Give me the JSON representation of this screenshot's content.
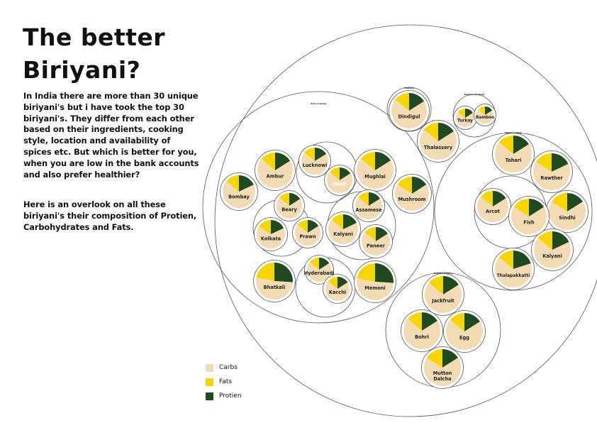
{
  "title": "The better Biriyani?",
  "paragraphs": [
    "In India there are more than 30 unique biriyani's but i have took the top 30 biriyani's. They differ from each other based on their ingredients, cooking style, location and availability of spices etc. But which is better for you, when you are low in the bank accounts and also prefer healthier?",
    "Here is an overlook on all these biriyani's their composition of Protien, Carbohydrates and Fats."
  ],
  "colors": {
    "carbs": "#f3dcb4",
    "fats": "#f6d500",
    "protein": "#1f4a1f",
    "outline": "#555555"
  },
  "legend": [
    {
      "key": "carbs",
      "label": "Carbs"
    },
    {
      "key": "fats",
      "label": "Fats"
    },
    {
      "key": "protein",
      "label": "Protien"
    }
  ],
  "chart_data": {
    "type": "pie",
    "layout": "nested-circle-packing",
    "legend_position": "bottom-left",
    "series_order": [
      "Carbs",
      "Fats",
      "Protien"
    ],
    "groups": [
      {
        "label": "Dum cooking",
        "subgroups": [
          {
            "items": [
              {
                "name": "Ambur",
                "carbs": 70,
                "fats": 14,
                "protein": 16
              },
              {
                "name": "Bombay",
                "carbs": 68,
                "fats": 14,
                "protein": 18
              },
              {
                "name": "Mughlai",
                "carbs": 70,
                "fats": 14,
                "protein": 16
              },
              {
                "name": "Mushroom",
                "carbs": 68,
                "fats": 16,
                "protein": 16
              },
              {
                "name": "Bhatkali",
                "carbs": 52,
                "fats": 22,
                "protein": 26
              },
              {
                "name": "Memoni",
                "carbs": 52,
                "fats": 22,
                "protein": 26
              }
            ]
          },
          {
            "items": [
              {
                "name": "Lucknowi",
                "carbs": 70,
                "fats": 14,
                "protein": 16
              },
              {
                "name": "Haidi",
                "carbs": 70,
                "fats": 14,
                "protein": 16
              }
            ]
          },
          {
            "items": [
              {
                "name": "Beary",
                "carbs": 70,
                "fats": 14,
                "protein": 16
              },
              {
                "name": "Kolkata",
                "carbs": 66,
                "fats": 16,
                "protein": 18
              },
              {
                "name": "Prawn",
                "carbs": 70,
                "fats": 14,
                "protein": 16
              }
            ]
          },
          {
            "items": [
              {
                "name": "Assamese",
                "carbs": 70,
                "fats": 14,
                "protein": 16
              },
              {
                "name": "Kalyani",
                "carbs": 68,
                "fats": 14,
                "protein": 18
              },
              {
                "name": "Paneer",
                "carbs": 70,
                "fats": 14,
                "protein": 16
              }
            ]
          },
          {
            "items": [
              {
                "name": "Hyderabadi",
                "carbs": 70,
                "fats": 14,
                "protein": 16
              },
              {
                "name": "Kacchi",
                "carbs": 70,
                "fats": 14,
                "protein": 16
              }
            ]
          }
        ]
      },
      {
        "label": "Dum/Kg",
        "items": [
          {
            "name": "Dindigul",
            "carbs": 70,
            "fats": 14,
            "protein": 16
          }
        ]
      },
      {
        "label": "Bamboo Cooking",
        "items": [
          {
            "name": "Turkay",
            "carbs": 70,
            "fats": 14,
            "protein": 16
          },
          {
            "name": "Bamboo",
            "carbs": 70,
            "fats": 14,
            "protein": 16
          }
        ]
      },
      {
        "label": "Layering",
        "items": [
          {
            "name": "Thalassery",
            "carbs": 70,
            "fats": 14,
            "protein": 16
          }
        ]
      },
      {
        "label": "Pakki cooking",
        "items": [
          {
            "name": "Tahari",
            "carbs": 70,
            "fats": 14,
            "protein": 16
          },
          {
            "name": "Rawther",
            "carbs": 66,
            "fats": 16,
            "protein": 18
          },
          {
            "name": "Sindhi",
            "carbs": 68,
            "fats": 16,
            "protein": 16
          },
          {
            "name": "Kalyani",
            "carbs": 68,
            "fats": 14,
            "protein": 18
          },
          {
            "name": "Thalapakkatti",
            "carbs": 66,
            "fats": 14,
            "protein": 20
          }
        ],
        "subgroups": [
          {
            "items": [
              {
                "name": "Arcot",
                "carbs": 70,
                "fats": 14,
                "protein": 16
              },
              {
                "name": "Fish",
                "carbs": 68,
                "fats": 16,
                "protein": 16
              }
            ]
          }
        ]
      },
      {
        "label": "Kalyani cooking",
        "items": [
          {
            "name": "Jackfruit",
            "carbs": 70,
            "fats": 14,
            "protein": 16
          },
          {
            "name": "Bohri",
            "carbs": 70,
            "fats": 14,
            "protein": 16
          },
          {
            "name": "Egg",
            "carbs": 70,
            "fats": 14,
            "protein": 16
          },
          {
            "name": "Mutton Dalcha",
            "carbs": 68,
            "fats": 16,
            "protein": 16
          }
        ]
      }
    ]
  }
}
